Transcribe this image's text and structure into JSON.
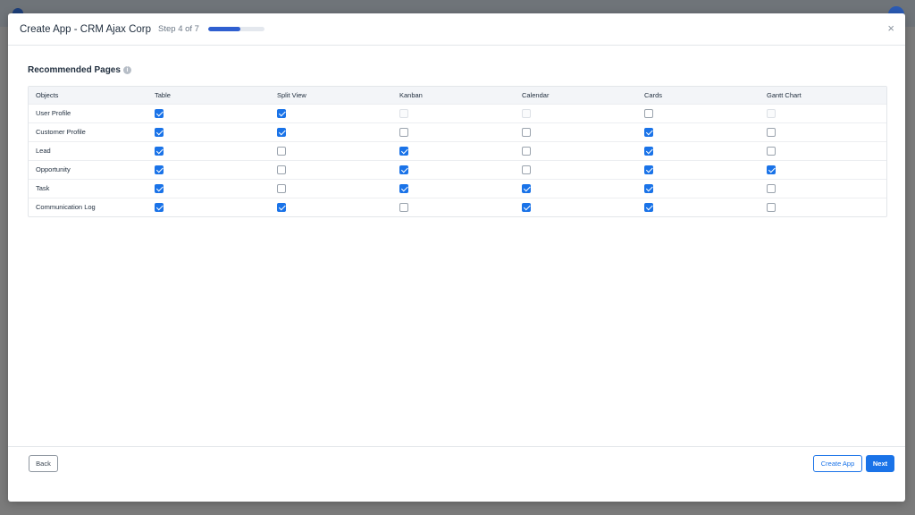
{
  "modal": {
    "title": "Create App  - CRM Ajax Corp",
    "step_label": "Step 4 of 7",
    "progress_fraction": 0.57,
    "close_glyph": "×"
  },
  "section": {
    "title": "Recommended Pages",
    "info_glyph": "i"
  },
  "table": {
    "headers": [
      "Objects",
      "Table",
      "Split View",
      "Kanban",
      "Calendar",
      "Cards",
      "Gantt Chart"
    ],
    "rows": [
      {
        "name": "User Profile",
        "cells": [
          "checked",
          "checked",
          "disabled",
          "disabled",
          "unchecked",
          "disabled"
        ]
      },
      {
        "name": "Customer Profile",
        "cells": [
          "checked",
          "checked",
          "unchecked",
          "unchecked",
          "checked",
          "unchecked"
        ]
      },
      {
        "name": "Lead",
        "cells": [
          "checked",
          "unchecked",
          "checked",
          "unchecked",
          "checked",
          "unchecked"
        ]
      },
      {
        "name": "Opportunity",
        "cells": [
          "checked",
          "unchecked",
          "checked",
          "unchecked",
          "checked",
          "checked"
        ]
      },
      {
        "name": "Task",
        "cells": [
          "checked",
          "unchecked",
          "checked",
          "checked",
          "checked",
          "unchecked"
        ]
      },
      {
        "name": "Communication Log",
        "cells": [
          "checked",
          "checked",
          "unchecked",
          "checked",
          "checked",
          "unchecked"
        ]
      }
    ]
  },
  "footer": {
    "back_label": "Back",
    "create_label": "Create App",
    "next_label": "Next"
  },
  "colors": {
    "accent": "#1a73e8",
    "progress": "#2f5fd0"
  }
}
